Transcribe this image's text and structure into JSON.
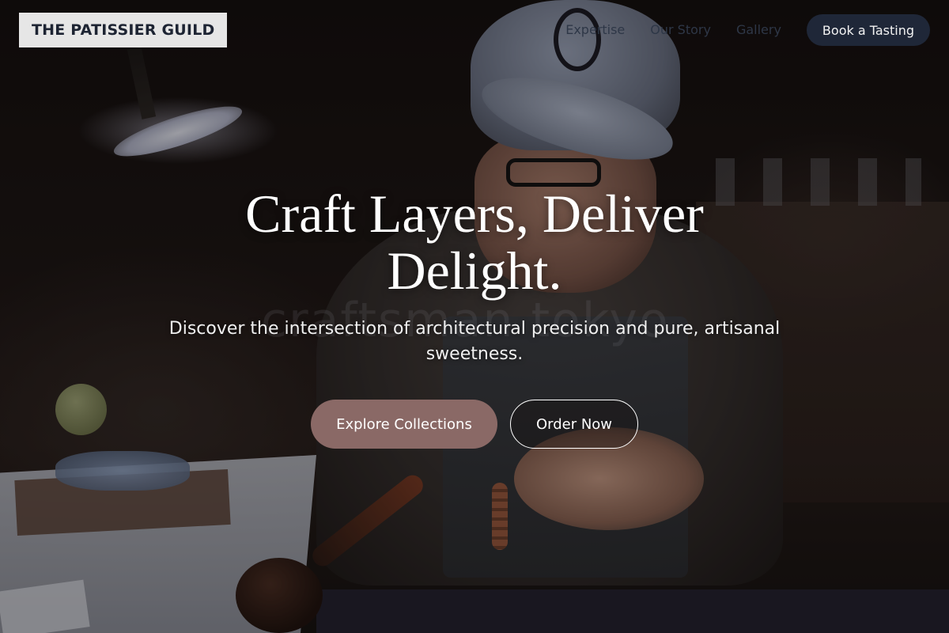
{
  "header": {
    "logo_text": "THE PATISSIER GUILD",
    "nav": [
      {
        "label": "Expertise"
      },
      {
        "label": "Our Story"
      },
      {
        "label": "Gallery"
      }
    ],
    "cta_label": "Book a Tasting"
  },
  "hero": {
    "title": "Craft Layers, Deliver Delight.",
    "subtitle": "Discover the intersection of architectural precision and pure, artisanal sweetness.",
    "primary_button": "Explore Collections",
    "secondary_button": "Order Now",
    "background_watermark": "craftsman tokyo"
  },
  "colors": {
    "logo_bg": "#e6e6e6",
    "logo_text": "#1d2433",
    "nav_text": "#2e3747",
    "cta_bg": "#1f2738",
    "primary_button_bg": "#8a6966",
    "hero_text": "#ffffff"
  }
}
